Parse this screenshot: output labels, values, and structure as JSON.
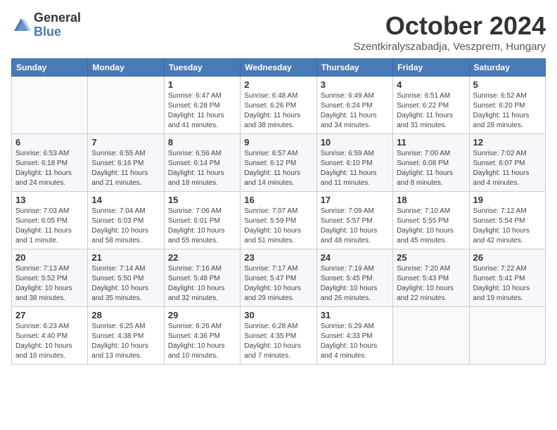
{
  "logo": {
    "general": "General",
    "blue": "Blue"
  },
  "title": "October 2024",
  "subtitle": "Szentkiralyszabadja, Veszprem, Hungary",
  "days_header": [
    "Sunday",
    "Monday",
    "Tuesday",
    "Wednesday",
    "Thursday",
    "Friday",
    "Saturday"
  ],
  "weeks": [
    [
      {
        "day": "",
        "info": ""
      },
      {
        "day": "",
        "info": ""
      },
      {
        "day": "1",
        "info": "Sunrise: 6:47 AM\nSunset: 6:28 PM\nDaylight: 11 hours and 41 minutes."
      },
      {
        "day": "2",
        "info": "Sunrise: 6:48 AM\nSunset: 6:26 PM\nDaylight: 11 hours and 38 minutes."
      },
      {
        "day": "3",
        "info": "Sunrise: 6:49 AM\nSunset: 6:24 PM\nDaylight: 11 hours and 34 minutes."
      },
      {
        "day": "4",
        "info": "Sunrise: 6:51 AM\nSunset: 6:22 PM\nDaylight: 11 hours and 31 minutes."
      },
      {
        "day": "5",
        "info": "Sunrise: 6:52 AM\nSunset: 6:20 PM\nDaylight: 11 hours and 28 minutes."
      }
    ],
    [
      {
        "day": "6",
        "info": "Sunrise: 6:53 AM\nSunset: 6:18 PM\nDaylight: 11 hours and 24 minutes."
      },
      {
        "day": "7",
        "info": "Sunrise: 6:55 AM\nSunset: 6:16 PM\nDaylight: 11 hours and 21 minutes."
      },
      {
        "day": "8",
        "info": "Sunrise: 6:56 AM\nSunset: 6:14 PM\nDaylight: 11 hours and 18 minutes."
      },
      {
        "day": "9",
        "info": "Sunrise: 6:57 AM\nSunset: 6:12 PM\nDaylight: 11 hours and 14 minutes."
      },
      {
        "day": "10",
        "info": "Sunrise: 6:59 AM\nSunset: 6:10 PM\nDaylight: 11 hours and 11 minutes."
      },
      {
        "day": "11",
        "info": "Sunrise: 7:00 AM\nSunset: 6:08 PM\nDaylight: 11 hours and 8 minutes."
      },
      {
        "day": "12",
        "info": "Sunrise: 7:02 AM\nSunset: 6:07 PM\nDaylight: 11 hours and 4 minutes."
      }
    ],
    [
      {
        "day": "13",
        "info": "Sunrise: 7:03 AM\nSunset: 6:05 PM\nDaylight: 11 hours and 1 minute."
      },
      {
        "day": "14",
        "info": "Sunrise: 7:04 AM\nSunset: 6:03 PM\nDaylight: 10 hours and 58 minutes."
      },
      {
        "day": "15",
        "info": "Sunrise: 7:06 AM\nSunset: 6:01 PM\nDaylight: 10 hours and 55 minutes."
      },
      {
        "day": "16",
        "info": "Sunrise: 7:07 AM\nSunset: 5:59 PM\nDaylight: 10 hours and 51 minutes."
      },
      {
        "day": "17",
        "info": "Sunrise: 7:09 AM\nSunset: 5:57 PM\nDaylight: 10 hours and 48 minutes."
      },
      {
        "day": "18",
        "info": "Sunrise: 7:10 AM\nSunset: 5:55 PM\nDaylight: 10 hours and 45 minutes."
      },
      {
        "day": "19",
        "info": "Sunrise: 7:12 AM\nSunset: 5:54 PM\nDaylight: 10 hours and 42 minutes."
      }
    ],
    [
      {
        "day": "20",
        "info": "Sunrise: 7:13 AM\nSunset: 5:52 PM\nDaylight: 10 hours and 38 minutes."
      },
      {
        "day": "21",
        "info": "Sunrise: 7:14 AM\nSunset: 5:50 PM\nDaylight: 10 hours and 35 minutes."
      },
      {
        "day": "22",
        "info": "Sunrise: 7:16 AM\nSunset: 5:48 PM\nDaylight: 10 hours and 32 minutes."
      },
      {
        "day": "23",
        "info": "Sunrise: 7:17 AM\nSunset: 5:47 PM\nDaylight: 10 hours and 29 minutes."
      },
      {
        "day": "24",
        "info": "Sunrise: 7:19 AM\nSunset: 5:45 PM\nDaylight: 10 hours and 26 minutes."
      },
      {
        "day": "25",
        "info": "Sunrise: 7:20 AM\nSunset: 5:43 PM\nDaylight: 10 hours and 22 minutes."
      },
      {
        "day": "26",
        "info": "Sunrise: 7:22 AM\nSunset: 5:41 PM\nDaylight: 10 hours and 19 minutes."
      }
    ],
    [
      {
        "day": "27",
        "info": "Sunrise: 6:23 AM\nSunset: 4:40 PM\nDaylight: 10 hours and 16 minutes."
      },
      {
        "day": "28",
        "info": "Sunrise: 6:25 AM\nSunset: 4:38 PM\nDaylight: 10 hours and 13 minutes."
      },
      {
        "day": "29",
        "info": "Sunrise: 6:26 AM\nSunset: 4:36 PM\nDaylight: 10 hours and 10 minutes."
      },
      {
        "day": "30",
        "info": "Sunrise: 6:28 AM\nSunset: 4:35 PM\nDaylight: 10 hours and 7 minutes."
      },
      {
        "day": "31",
        "info": "Sunrise: 6:29 AM\nSunset: 4:33 PM\nDaylight: 10 hours and 4 minutes."
      },
      {
        "day": "",
        "info": ""
      },
      {
        "day": "",
        "info": ""
      }
    ]
  ]
}
